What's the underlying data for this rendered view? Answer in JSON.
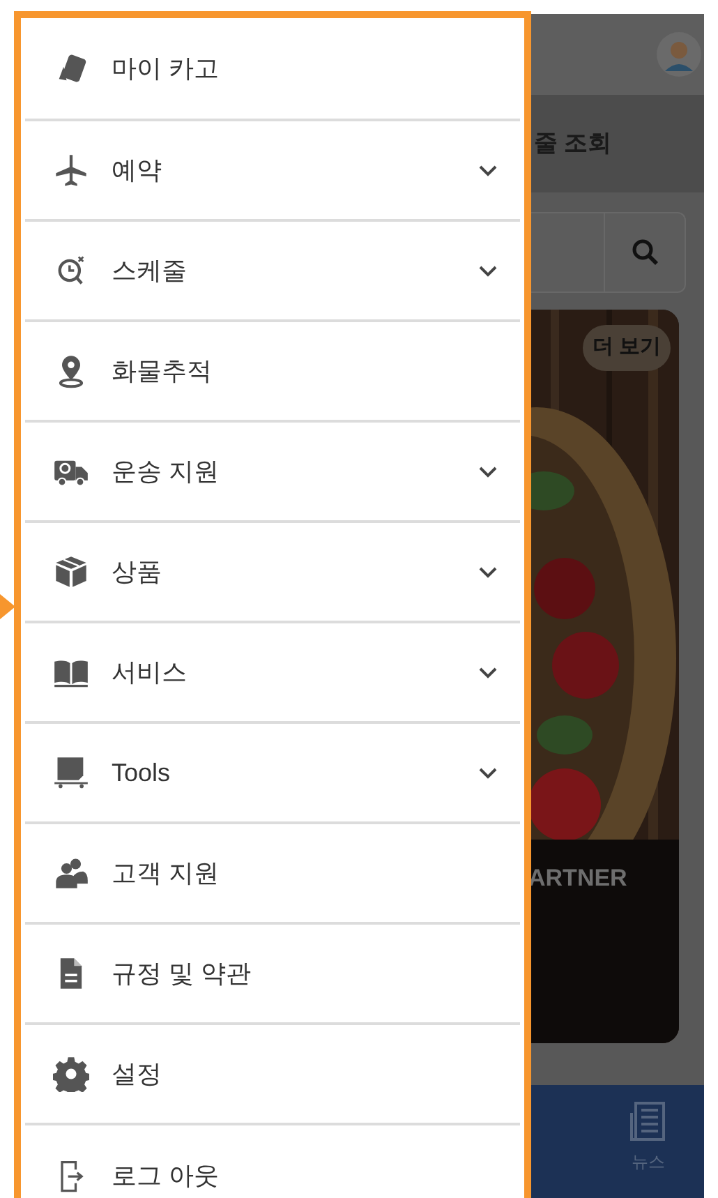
{
  "menu": [
    {
      "label": "마이 카고",
      "expandable": false
    },
    {
      "label": "예약",
      "expandable": true
    },
    {
      "label": "스케줄",
      "expandable": true
    },
    {
      "label": "화물추적",
      "expandable": false
    },
    {
      "label": "운송 지원",
      "expandable": true
    },
    {
      "label": "상품",
      "expandable": true
    },
    {
      "label": "서비스",
      "expandable": true
    },
    {
      "label": "Tools",
      "expandable": true
    },
    {
      "label": "고객 지원",
      "expandable": false
    },
    {
      "label": "규정 및 약관",
      "expandable": false
    },
    {
      "label": "설정",
      "expandable": false
    },
    {
      "label": "로그 아웃",
      "expandable": false
    }
  ],
  "background": {
    "heading": "줄 조회",
    "card": {
      "more_button": "더 보기",
      "caption": "ARTNER"
    },
    "bottom_nav": [
      {
        "label": "뉴스"
      }
    ]
  }
}
